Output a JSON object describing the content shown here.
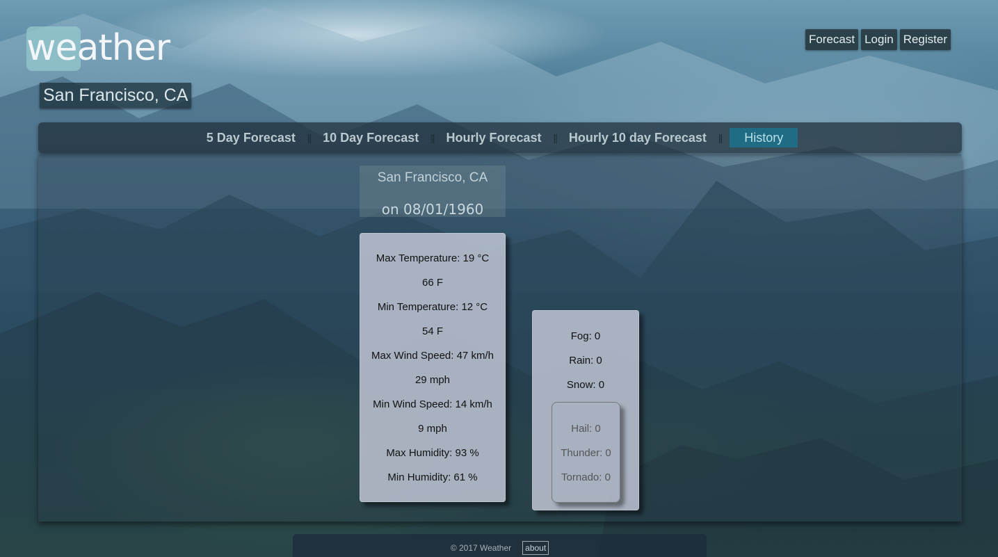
{
  "brand": {
    "logo_text": "weather"
  },
  "location_badge": "San Francisco, CA",
  "top_nav": {
    "forecast": "Forecast",
    "login": "Login",
    "register": "Register"
  },
  "tabs": [
    {
      "label": "5 Day Forecast"
    },
    {
      "label": "10 Day Forecast"
    },
    {
      "label": "Hourly Forecast"
    },
    {
      "label": "Hourly 10 day Forecast"
    },
    {
      "label": "History",
      "active": true
    }
  ],
  "tab_separator": "||",
  "history": {
    "location": "San Francisco, CA",
    "date": "on 08/01/1960",
    "stats": [
      "Max Temperature: 19 °C",
      "66 F",
      "Min Temperature: 12 °C",
      "54 F",
      "Max Wind Speed: 47 km/h",
      "29 mph",
      "Min Wind Speed: 14 km/h",
      "9 mph",
      "Max Humidity: 93 %",
      "Min Humidity: 61 %"
    ],
    "precip": [
      "Fog: 0",
      "Rain: 0",
      "Snow: 0"
    ],
    "severe": [
      "Hail: 0",
      "Thunder: 0",
      "Tornado: 0"
    ]
  },
  "footer": {
    "copyright": "© 2017 Weather",
    "about": "about"
  },
  "colors": {
    "active_tab": "#1f6c84",
    "logo_box": "#96c8cd"
  }
}
